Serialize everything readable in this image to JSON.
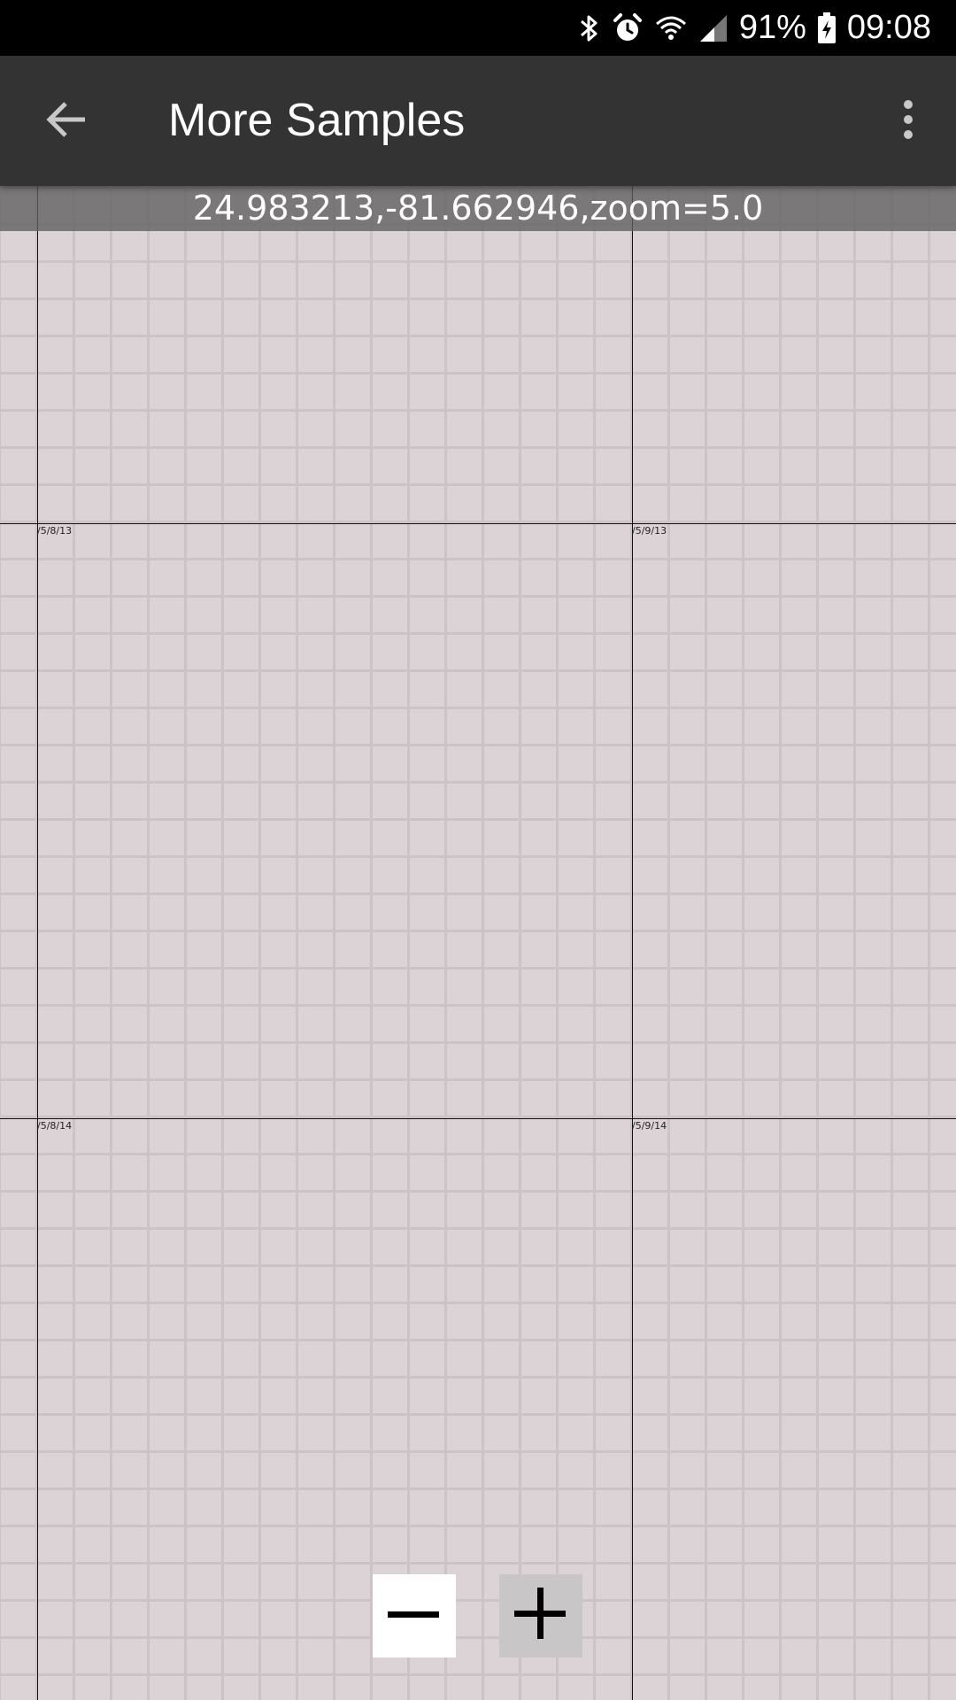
{
  "status_bar": {
    "battery": "91%",
    "time": "09:08",
    "icons": [
      "bluetooth-icon",
      "alarm-icon",
      "wifi-icon",
      "signal-icon",
      "battery-charging-icon"
    ]
  },
  "app_bar": {
    "title": "More Samples",
    "back_icon": "arrow-back-icon",
    "menu_icon": "more-vert-icon"
  },
  "map": {
    "coordinate_readout": "24.983213,-81.662946,zoom=5.0",
    "tile_labels": [
      "/5/8/13",
      "/5/9/13",
      "/5/8/14",
      "/5/9/14"
    ]
  },
  "zoom_controls": {
    "zoom_out_icon": "minus-icon",
    "zoom_in_icon": "plus-icon"
  }
}
